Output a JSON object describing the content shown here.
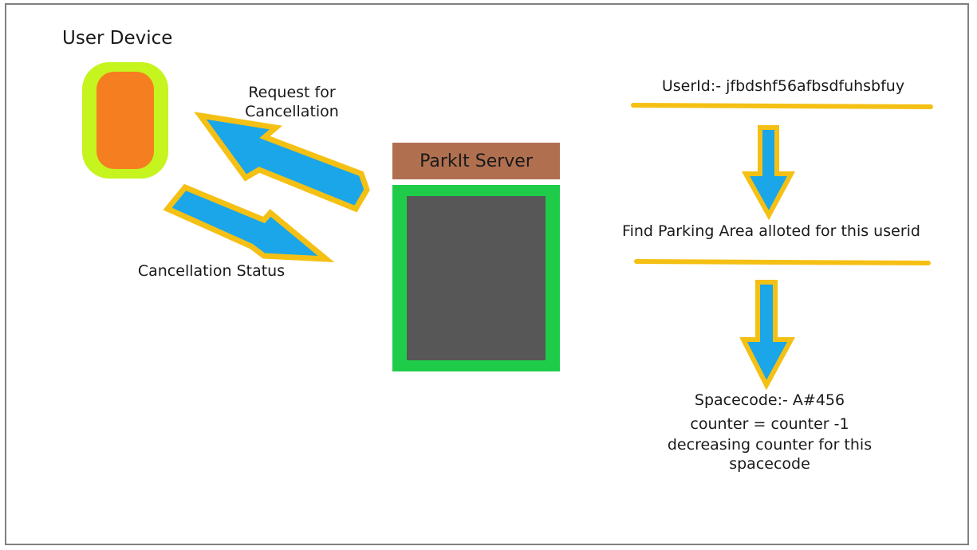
{
  "user_device": {
    "label": "User Device"
  },
  "request": {
    "label": "Request for Cancellation"
  },
  "status": {
    "label": "Cancellation Status"
  },
  "server": {
    "label": "ParkIt Server"
  },
  "flow": {
    "userid": "UserId:- jfbdshf56afbsdfuhsbfuy",
    "find": "Find Parking Area alloted for this userid",
    "spacecode": "Spacecode:- A#456",
    "counter": "counter = counter -1",
    "decreasing": "decreasing counter for this spacecode"
  },
  "colors": {
    "arrow_fill": "#1aa6e8",
    "arrow_outline": "#f5c014",
    "device_outer": "#c6f41e",
    "device_inner": "#f57f20",
    "server_header": "#b07050",
    "server_frame": "#1ecc4a",
    "server_screen": "#575757"
  }
}
